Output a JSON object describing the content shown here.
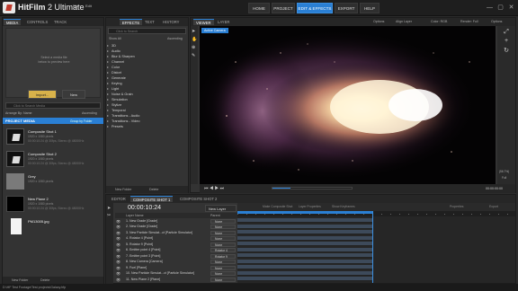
{
  "app": {
    "brand_bold": "HitFilm",
    "brand_rest": "2 Ultimate",
    "menu": [
      "File",
      "Edit"
    ],
    "nav": [
      "HOME",
      "PROJECT",
      "EDIT & EFFECTS",
      "EXPORT",
      "HELP"
    ],
    "active_nav": "EDIT & EFFECTS",
    "window_controls": [
      "—",
      "▢",
      "✕"
    ]
  },
  "media_panel": {
    "tabs": [
      "MEDIA",
      "CONTROLS",
      "TRACK"
    ],
    "preview_hint": "Select a media file below to preview here",
    "import_label": "Import...",
    "new_label": "New",
    "search_placeholder": "Click to Search Media",
    "arrange_label": "Arrange By: Name",
    "ascending_label": "Ascending",
    "section_label": "PROJECT MEDIA",
    "group_label": "Group by Folder",
    "items": [
      {
        "name": "Composite Shot 1",
        "detail": "1920 x 1080 pixels",
        "detail2": "00:00:10:24 @ 30fps, Stereo @ 48000Hz",
        "thumb": "dark"
      },
      {
        "name": "Composite Shot 2",
        "detail": "1920 x 1080 pixels",
        "detail2": "00:00:10:24 @ 30fps, Stereo @ 48000Hz",
        "thumb": "dark"
      },
      {
        "name": "Grey",
        "detail": "1920 x 1080 pixels",
        "detail2": "",
        "thumb": "grey"
      },
      {
        "name": "New Plane 2",
        "detail": "1920 x 1080 pixels",
        "detail2": "00:00:10:24 @ 30fps, Stereo @ 48000Hz",
        "thumb": "black"
      },
      {
        "name": "PM13005.jpg",
        "detail": "",
        "detail2": "",
        "thumb": "file"
      }
    ],
    "footer": [
      "New Folder",
      "Delete"
    ]
  },
  "effects_panel": {
    "tabs": [
      "EFFECTS",
      "TEXT",
      "HISTORY"
    ],
    "search_placeholder": "Click to Search",
    "sort_label": "Show All",
    "ascending_label": "Ascending",
    "categories": [
      "3D",
      "Audio",
      "Blur & Sharpen",
      "Channel",
      "Color",
      "Distort",
      "Generate",
      "Keying",
      "Light",
      "Noise & Grain",
      "Simulation",
      "Stylize",
      "Temporal",
      "Transitions - Audio",
      "Transitions - Video",
      "Presets"
    ],
    "footer": [
      "New Folder",
      "Delete"
    ]
  },
  "viewer": {
    "tabs": [
      "VIEWER",
      "LAYER"
    ],
    "options": [
      "Options",
      "Align Layer",
      "Color: RGB",
      "Render: Full",
      "Options"
    ],
    "camera_label": "Active Camera",
    "timecode": "00:00:00:00",
    "zoom": "(56.7%)",
    "full_label": "Full"
  },
  "editor": {
    "tabs": [
      "EDITOR",
      "COMPOSITE SHOT 1",
      "COMPOSITE SHOT 2"
    ],
    "timecode": "00:00:10:24",
    "new_layer_label": "New Layer",
    "layer_name_header": "Layer Name",
    "parent_header": "Parent",
    "track_buttons": [
      "Make Composite Shot",
      "Layer Properties",
      "Show Keyframes",
      "Properties",
      "Export"
    ],
    "layers": [
      {
        "name": "1. New Grade [Grade]",
        "parent": "None"
      },
      {
        "name": "2. New Grade [Grade]",
        "parent": "None"
      },
      {
        "name": "3. New Particle Simulat...ct [Particle Simulator]",
        "parent": "None"
      },
      {
        "name": "4. Rotator 4 [Point]",
        "parent": "None"
      },
      {
        "name": "5. Rotator 9 [Point]",
        "parent": "None"
      },
      {
        "name": "6. Emitter point 4 [Point]",
        "parent": "Rotator 4"
      },
      {
        "name": "7. Emitter point 3 [Point]",
        "parent": "Rotator 9"
      },
      {
        "name": "8. New Camera [Camera]",
        "parent": "None"
      },
      {
        "name": "9. Fuel [Plane]",
        "parent": "None"
      },
      {
        "name": "10. New Particle Simulat...ct [Particle Simulator]",
        "parent": "None"
      },
      {
        "name": "11. New Plane 2 [Plane]",
        "parent": "None"
      }
    ],
    "footer": [
      "New Folder",
      "Delete"
    ]
  },
  "statusbar": {
    "text": "D:\\HF Test Footage\\Test projects\\Galaxy.hfp"
  },
  "colors": {
    "accent": "#2a7fd4",
    "bg": "#2b2b2b",
    "panel": "#333333"
  }
}
